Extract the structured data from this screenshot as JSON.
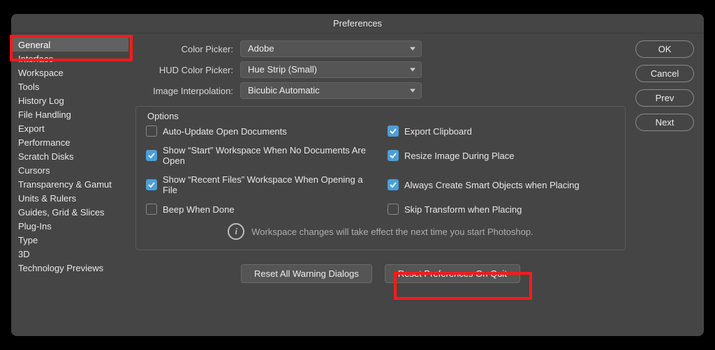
{
  "title": "Preferences",
  "sidebar": {
    "items": [
      {
        "label": "General",
        "selected": true
      },
      {
        "label": "Interface"
      },
      {
        "label": "Workspace"
      },
      {
        "label": "Tools"
      },
      {
        "label": "History Log"
      },
      {
        "label": "File Handling"
      },
      {
        "label": "Export"
      },
      {
        "label": "Performance"
      },
      {
        "label": "Scratch Disks"
      },
      {
        "label": "Cursors"
      },
      {
        "label": "Transparency & Gamut"
      },
      {
        "label": "Units & Rulers"
      },
      {
        "label": "Guides, Grid & Slices"
      },
      {
        "label": "Plug-Ins"
      },
      {
        "label": "Type"
      },
      {
        "label": "3D"
      },
      {
        "label": "Technology Previews"
      }
    ]
  },
  "pickers": {
    "color_picker_label": "Color Picker:",
    "color_picker_value": "Adobe",
    "hud_label": "HUD Color Picker:",
    "hud_value": "Hue Strip (Small)",
    "interp_label": "Image Interpolation:",
    "interp_value": "Bicubic Automatic"
  },
  "options": {
    "legend": "Options",
    "items": [
      {
        "label": "Auto-Update Open Documents",
        "checked": false
      },
      {
        "label": "Export Clipboard",
        "checked": true
      },
      {
        "label": "Show “Start” Workspace When No Documents Are Open",
        "checked": true
      },
      {
        "label": "Resize Image During Place",
        "checked": true
      },
      {
        "label": "Show “Recent Files” Workspace When Opening a File",
        "checked": true
      },
      {
        "label": "Always Create Smart Objects when Placing",
        "checked": true
      },
      {
        "label": "Beep When Done",
        "checked": false
      },
      {
        "label": "Skip Transform when Placing",
        "checked": false
      }
    ],
    "info_text": "Workspace changes will take effect the next time you start Photoshop."
  },
  "bottom": {
    "reset_warnings": "Reset All Warning Dialogs",
    "reset_prefs": "Reset Preferences On Quit"
  },
  "right": {
    "ok": "OK",
    "cancel": "Cancel",
    "prev": "Prev",
    "next": "Next"
  }
}
